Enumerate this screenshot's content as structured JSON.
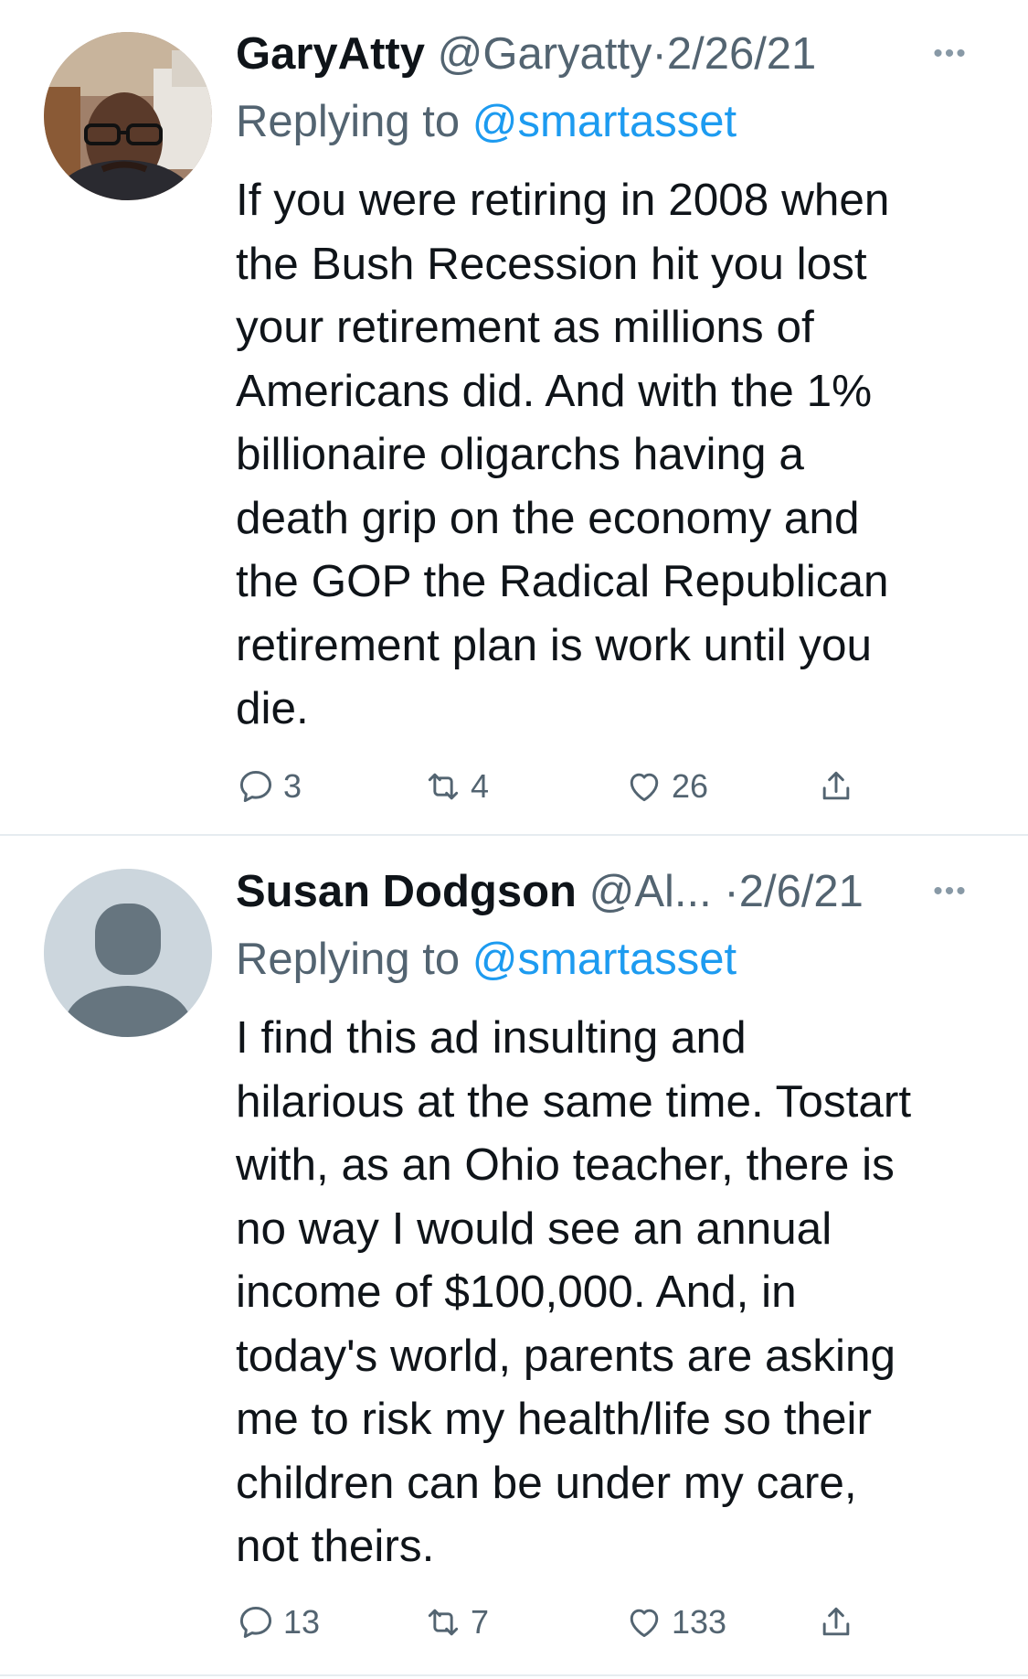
{
  "tweets": [
    {
      "name": "GaryAtty",
      "handle": "@Garyatty",
      "dot": "·",
      "date": "2/26/21",
      "more": "•••",
      "replying_prefix": "Replying to ",
      "replying_to": "@smartasset",
      "text": "If you were retiring in 2008 when\nthe Bush Recession hit you lost\nyour retirement as millions of\nAmericans did. And with the 1%\nbillionaire oligarchs having a\ndeath grip on the economy and\nthe GOP the Radical Republican\nretirement plan is work until you\ndie.",
      "replies": "3",
      "retweets": "4",
      "likes": "26"
    },
    {
      "name": "Susan Dodgson",
      "handle": "@Al...",
      "dot": "·",
      "date": "2/6/21",
      "more": "•••",
      "replying_prefix": "Replying to ",
      "replying_to": "@smartasset",
      "text": "I find this ad insulting and\nhilarious at the same time. Tostart\nwith, as an Ohio teacher, there is\nno way I would see an annual\nincome of $100,000. And, in\ntoday's world, parents are asking\nme to risk my health/life so their\nchildren can be under my care,\nnot theirs.",
      "replies": "13",
      "retweets": "7",
      "likes": "133"
    }
  ],
  "colors": {
    "text": "#0f1419",
    "secondary": "#536471",
    "link": "#1d9bf0",
    "divider": "#e6ecf0"
  }
}
